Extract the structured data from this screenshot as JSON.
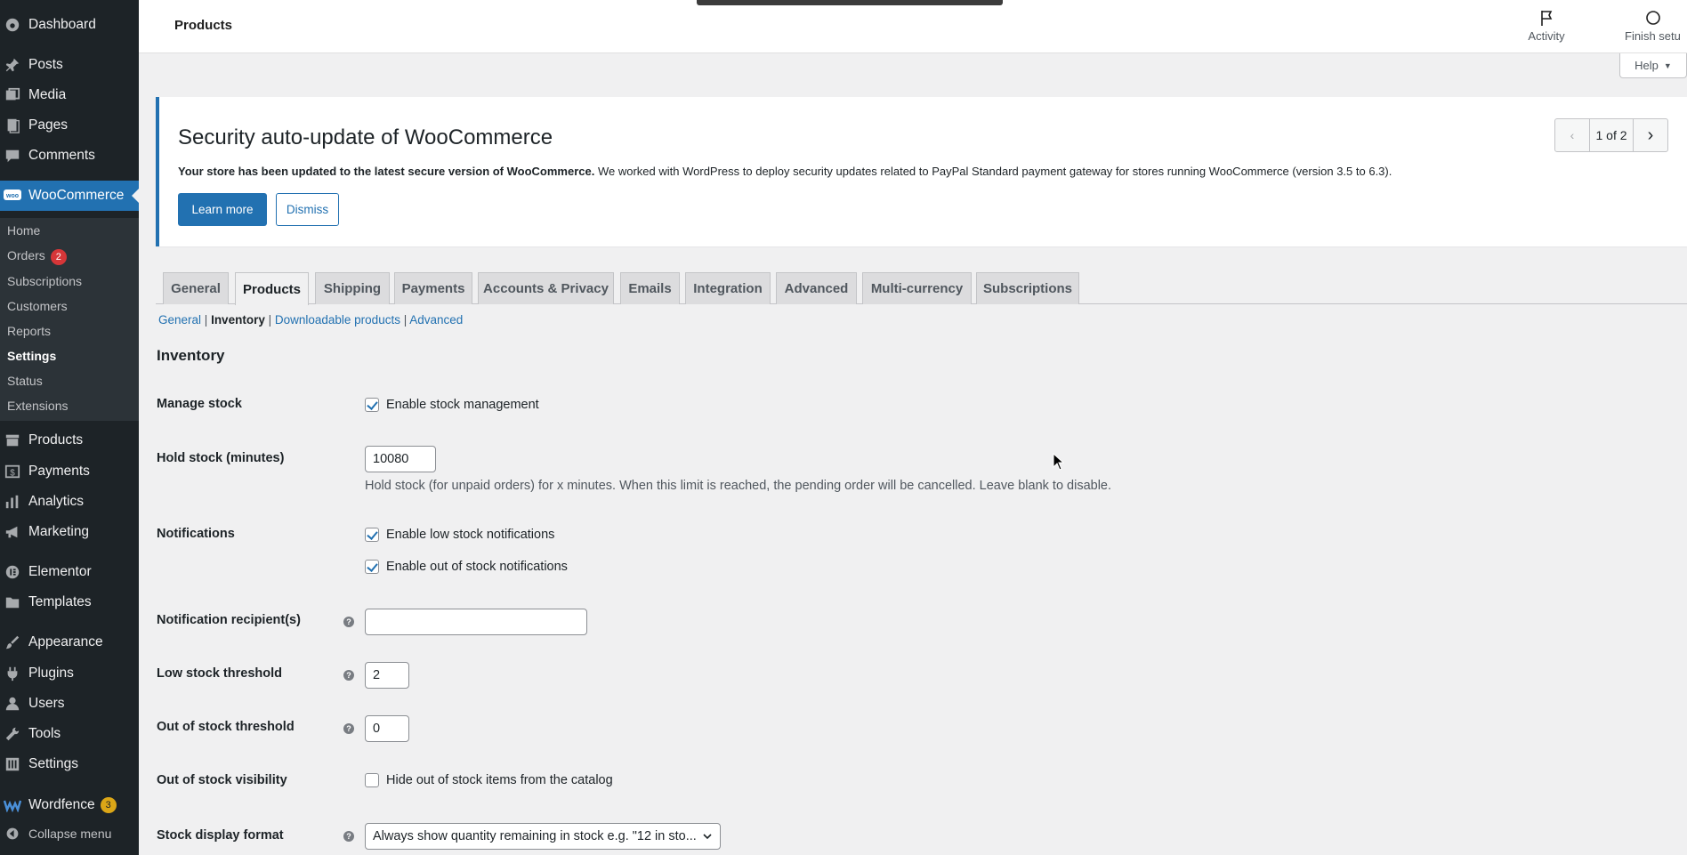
{
  "sidebar": {
    "menu": [
      {
        "label": "Dashboard",
        "icon": "dashboard-icon"
      },
      {
        "label": "Posts",
        "icon": "pin-icon"
      },
      {
        "label": "Media",
        "icon": "media-icon"
      },
      {
        "label": "Pages",
        "icon": "pages-icon"
      },
      {
        "label": "Comments",
        "icon": "comment-icon"
      },
      {
        "label": "WooCommerce",
        "icon": "woo-icon"
      },
      {
        "label": "Products",
        "icon": "archive-icon"
      },
      {
        "label": "Payments",
        "icon": "dollar-icon"
      },
      {
        "label": "Analytics",
        "icon": "bar-chart-icon"
      },
      {
        "label": "Marketing",
        "icon": "megaphone-icon"
      },
      {
        "label": "Elementor",
        "icon": "elementor-icon"
      },
      {
        "label": "Templates",
        "icon": "folder-icon"
      },
      {
        "label": "Appearance",
        "icon": "brush-icon"
      },
      {
        "label": "Plugins",
        "icon": "plug-icon"
      },
      {
        "label": "Users",
        "icon": "user-icon"
      },
      {
        "label": "Tools",
        "icon": "wrench-icon"
      },
      {
        "label": "Settings",
        "icon": "settings-icon"
      },
      {
        "label": "Wordfence",
        "icon": "wordfence-icon",
        "badge": "3"
      },
      {
        "label": "Collapse menu",
        "icon": "collapse-icon"
      }
    ],
    "submenu": [
      {
        "label": "Home"
      },
      {
        "label": "Orders",
        "badge": "2"
      },
      {
        "label": "Subscriptions"
      },
      {
        "label": "Customers"
      },
      {
        "label": "Reports"
      },
      {
        "label": "Settings"
      },
      {
        "label": "Status"
      },
      {
        "label": "Extensions"
      }
    ]
  },
  "topbar": {
    "title": "Products",
    "activity": "Activity",
    "finish_setup": "Finish setu"
  },
  "help": "Help",
  "notice": {
    "title": "Security auto-update of WooCommerce",
    "body_bold": "Your store has been updated to the latest secure version of WooCommerce.",
    "body_rest": " We worked with WordPress to deploy security updates related to PayPal Standard payment gateway for stores running WooCommerce (version 3.5 to 6.3).",
    "learn_more": "Learn more",
    "dismiss": "Dismiss",
    "pager": "1 of 2"
  },
  "tabs": [
    "General",
    "Products",
    "Shipping",
    "Payments",
    "Accounts & Privacy",
    "Emails",
    "Integration",
    "Advanced",
    "Multi-currency",
    "Subscriptions"
  ],
  "subtabs": [
    "General",
    "Inventory",
    "Downloadable products",
    "Advanced"
  ],
  "section_title": "Inventory",
  "fields": {
    "manage_stock": {
      "label": "Manage stock",
      "checkbox": "Enable stock management",
      "checked": true
    },
    "hold_stock": {
      "label": "Hold stock (minutes)",
      "value": "10080",
      "desc": "Hold stock (for unpaid orders) for x minutes. When this limit is reached, the pending order will be cancelled. Leave blank to disable."
    },
    "notifications": {
      "label": "Notifications",
      "low": "Enable low stock notifications",
      "out": "Enable out of stock notifications"
    },
    "recipient": {
      "label": "Notification recipient(s)",
      "value": ""
    },
    "low_threshold": {
      "label": "Low stock threshold",
      "value": "2"
    },
    "out_threshold": {
      "label": "Out of stock threshold",
      "value": "0"
    },
    "visibility": {
      "label": "Out of stock visibility",
      "checkbox": "Hide out of stock items from the catalog",
      "checked": false
    },
    "display_format": {
      "label": "Stock display format",
      "value": "Always show quantity remaining in stock e.g. \"12 in sto..."
    }
  },
  "colors": {
    "accent": "#2271b1",
    "sidebar": "#1d2327"
  }
}
